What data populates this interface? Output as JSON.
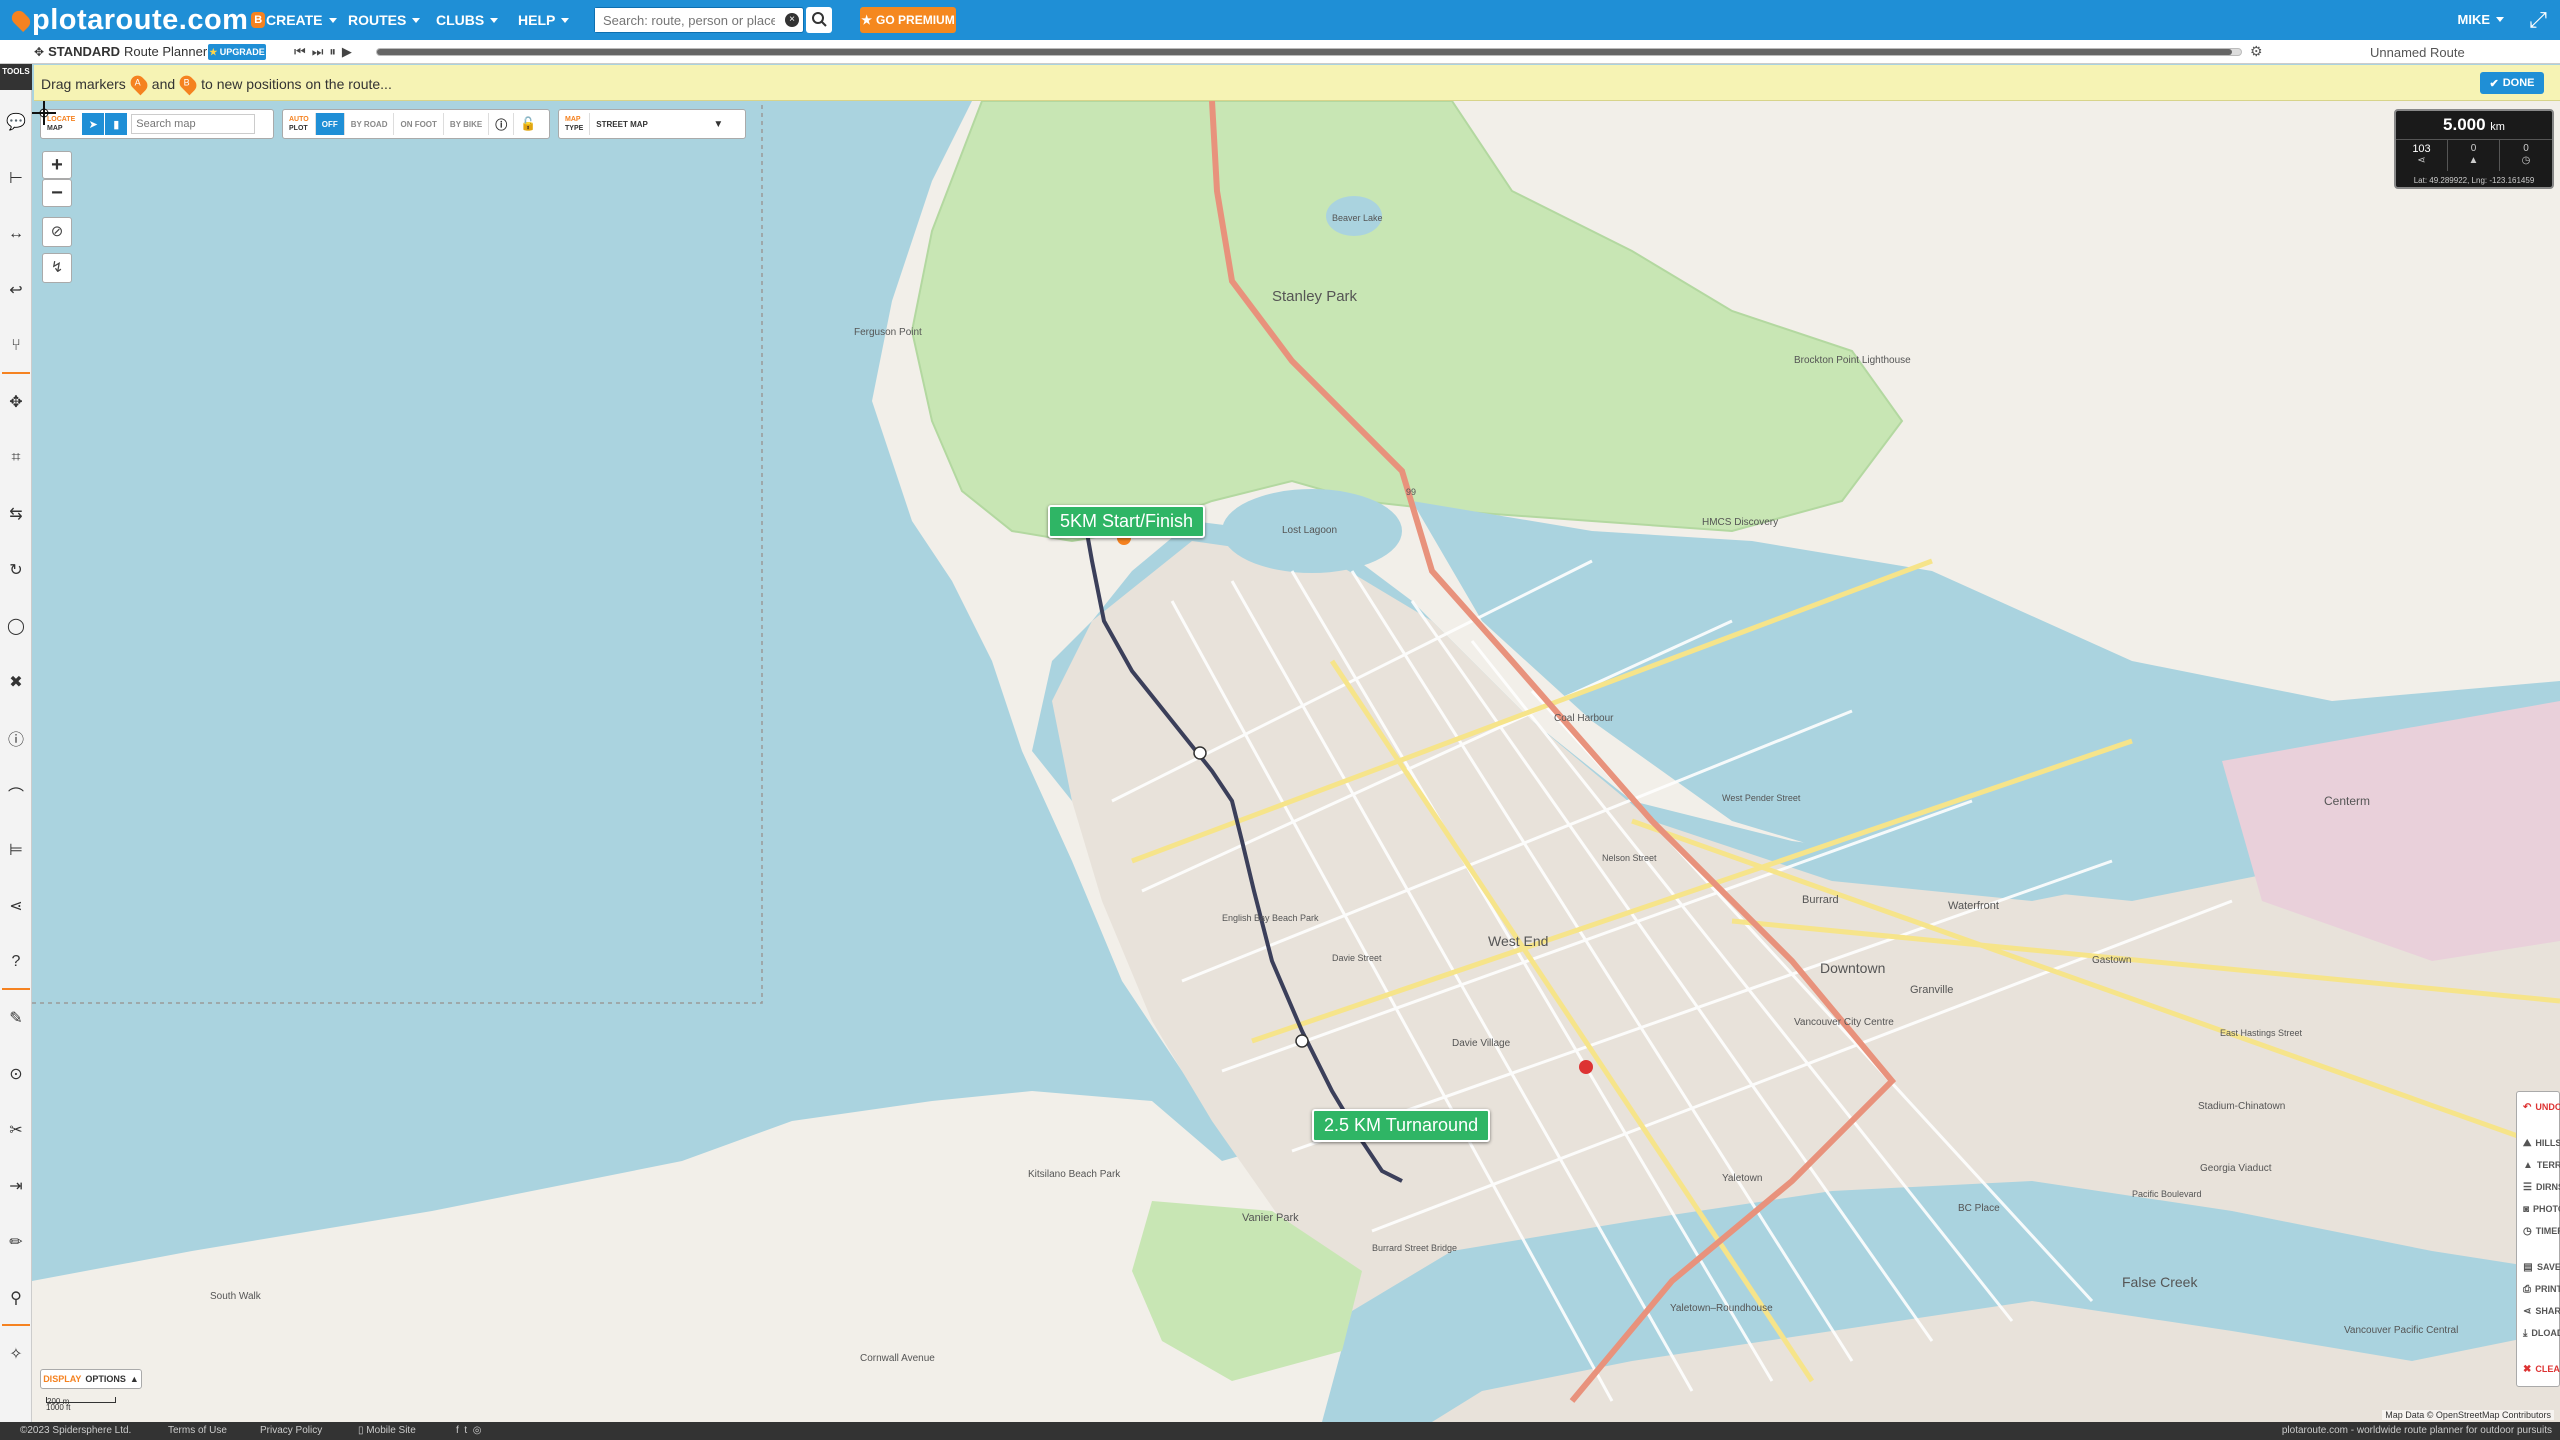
{
  "app": {
    "logo_text": "plotaroute.com",
    "logo_badge": "B"
  },
  "nav": {
    "menus": [
      "CREATE",
      "ROUTES",
      "CLUBS",
      "HELP"
    ],
    "search_placeholder": "Search: route, person or place",
    "premium_label": "GO PREMIUM",
    "user_label": "MIKE"
  },
  "subbar": {
    "planner_mode": "STANDARD",
    "planner_name": "Route Planner",
    "upgrade_label": "UPGRADE",
    "route_name": "Unnamed Route",
    "playback_progress": 0.995
  },
  "instruction": {
    "part1": "Drag markers",
    "marker_a": "A",
    "part2": "and",
    "marker_b": "B",
    "part3": "to new positions on the route...",
    "done_label": "DONE"
  },
  "toolbar": {
    "head": "TOOLS",
    "icons": [
      "comment-icon",
      "route-start-icon",
      "line-icon",
      "back-icon",
      "fork-icon",
      "move-icon",
      "crop-icon",
      "swap-icon",
      "loop-icon",
      "circle-route-icon",
      "delete-point-icon",
      "info-icon",
      "bridge-icon",
      "span-icon",
      "share-icon",
      "help-icon",
      "pencil-icon",
      "location-icon",
      "scissors-icon",
      "join-icon",
      "edit-icon",
      "pin-icon",
      "wand-icon"
    ]
  },
  "map_controls": {
    "locate": {
      "label_top": "LOCATE",
      "label_bottom": "MAP",
      "placeholder": "Search map"
    },
    "autoplot": {
      "label_top": "AUTO",
      "label_bottom": "PLOT",
      "options": [
        "OFF",
        "BY ROAD",
        "ON FOOT",
        "BY BIKE"
      ],
      "selected": "OFF"
    },
    "maptype": {
      "label_top": "MAP",
      "label_bottom": "TYPE",
      "selected": "STREET MAP"
    },
    "display_options": {
      "label_a": "DISPLAY",
      "label_b": "OPTIONS"
    },
    "scale": {
      "top": "200 m",
      "bottom": "1000 ft"
    }
  },
  "distance_panel": {
    "value": "5.000",
    "unit": "km",
    "cells": [
      "103",
      "0",
      "0"
    ],
    "latlng": "Lat: 49.289922, Lng: -123.161459"
  },
  "route_labels": {
    "start_finish": "5KM Start/Finish",
    "turnaround": "2.5 KM Turnaround"
  },
  "right_panel": {
    "items": [
      {
        "label": "UNDO",
        "icon": "undo-icon",
        "red": true
      },
      {
        "label": "HILLS",
        "icon": "hills-icon",
        "red": false
      },
      {
        "label": "TERRAIN",
        "icon": "terrain-icon",
        "red": false
      },
      {
        "label": "DIRNS",
        "icon": "directions-icon",
        "red": false
      },
      {
        "label": "PHOTOS",
        "icon": "camera-icon",
        "red": false
      },
      {
        "label": "TIMER",
        "icon": "timer-icon",
        "red": false
      },
      {
        "label": "SAVE",
        "icon": "save-icon",
        "red": false
      },
      {
        "label": "PRINT",
        "icon": "print-icon",
        "red": false
      },
      {
        "label": "SHARE",
        "icon": "share-icon",
        "red": false
      },
      {
        "label": "DLOAD",
        "icon": "download-icon",
        "red": false
      },
      {
        "label": "CLEAR",
        "icon": "clear-icon",
        "red": true
      }
    ]
  },
  "map_labels": {
    "stanley_park": "Stanley Park",
    "ferguson_point": "Ferguson Point",
    "beaver_lake": "Beaver Lake",
    "brockton": "Brockton Point Lighthouse",
    "lost_lagoon": "Lost Lagoon",
    "coal_harbour": "Coal Harbour",
    "hmcs": "HMCS Discovery",
    "west_end": "West End",
    "downtown": "Downtown",
    "english_bay": "English Bay Beach Park",
    "davie_village": "Davie Village",
    "vancouver_city_centre": "Vancouver City Centre",
    "waterfront": "Waterfront",
    "burrard": "Burrard",
    "granville": "Granville",
    "gastown": "Gastown",
    "chinatown": "Stadium-Chinatown",
    "yaletown": "Yaletown",
    "false_creek": "False Creek",
    "vanier_park": "Vanier Park",
    "kitsilano": "Kitsilano Beach Park",
    "centerm": "Centerm",
    "south_walk": "South Walk",
    "cornwall": "Cornwall Avenue",
    "bc_place": "BC Place",
    "georgia_viaduct": "Georgia Viaduct",
    "pacific_boulevard": "Pacific Boulevard",
    "west_pender": "West Pender Street",
    "davie_street": "Davie Street",
    "nelson_street": "Nelson Street",
    "burrard_bridge": "Burrard Street Bridge",
    "east_hastings": "East Hastings Street",
    "yaletown_roundhouse": "Yaletown–Roundhouse",
    "vancouver_central": "Vancouver Pacific Central",
    "highway_99": "99"
  },
  "attribution": "Map Data © OpenStreetMap Contributors",
  "footer": {
    "copyright": "©2023 Spidersphere Ltd.",
    "terms": "Terms of Use",
    "privacy": "Privacy Policy",
    "mobile": "Mobile Site",
    "tagline": "plotaroute.com - worldwide route planner for outdoor pursuits"
  },
  "colors": {
    "brand_blue": "#1f8fd6",
    "accent_orange": "#f58220",
    "water": "#aad3df",
    "park": "#c8e6b4",
    "route_label_green": "#2fb565"
  }
}
